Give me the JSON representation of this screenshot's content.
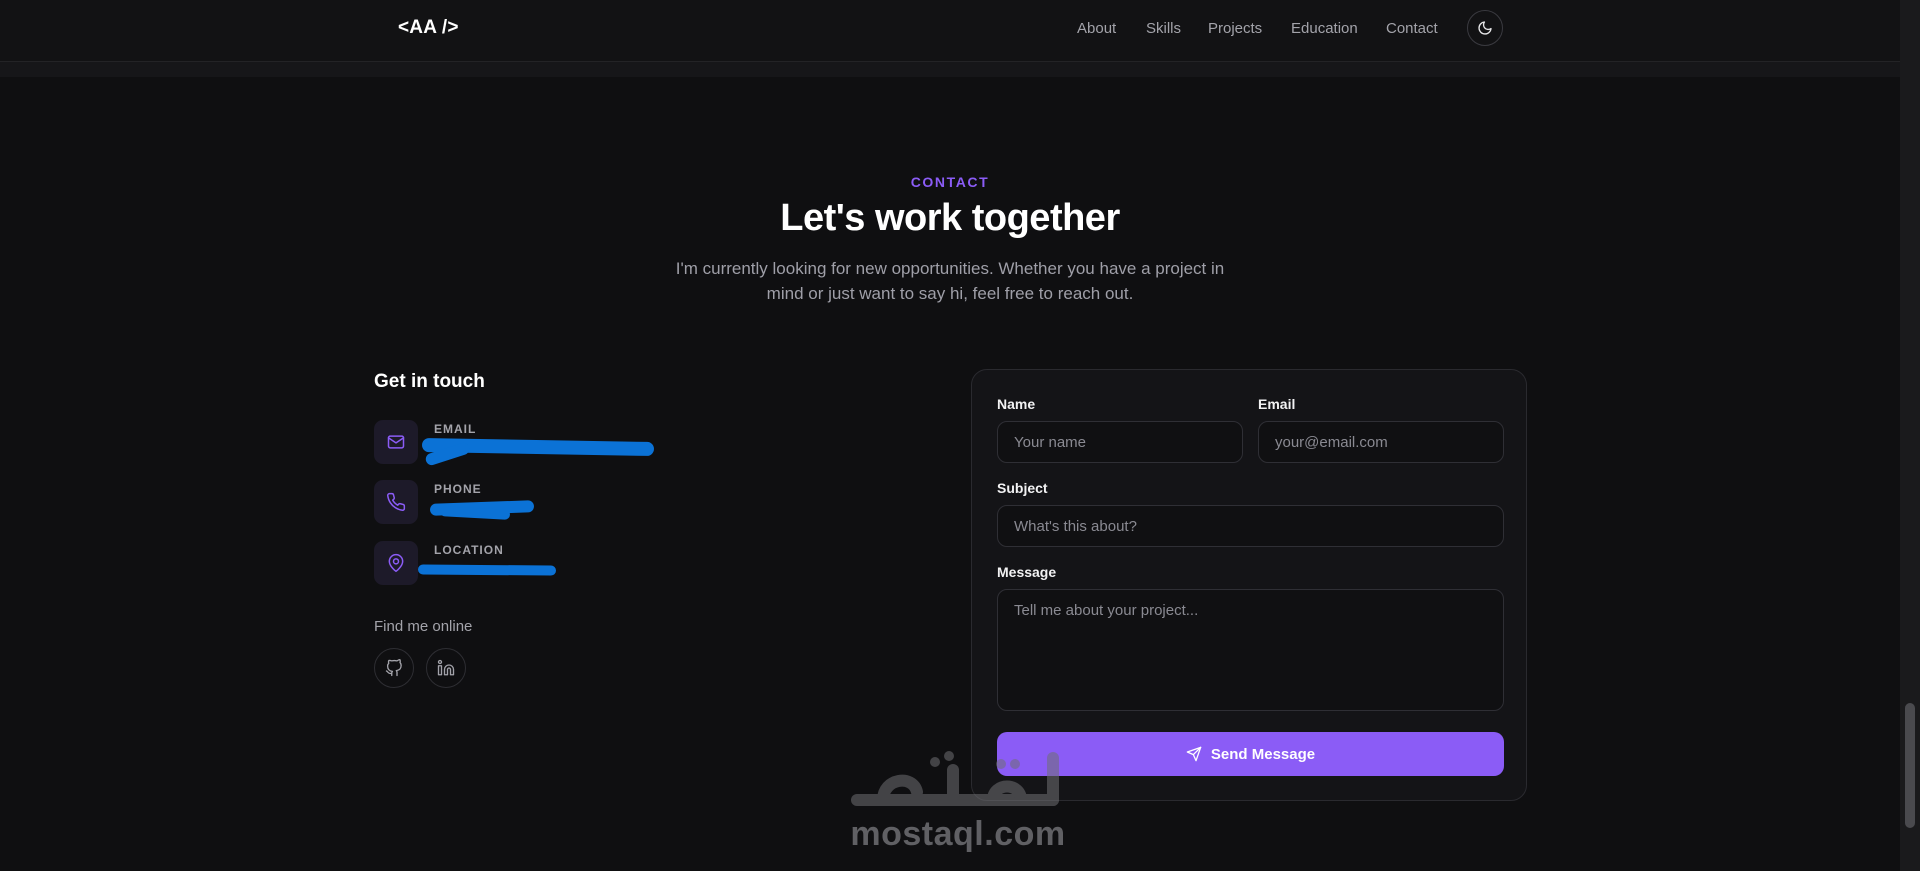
{
  "header": {
    "logo": "<AA />",
    "nav": [
      "About",
      "Skills",
      "Projects",
      "Education",
      "Contact"
    ],
    "theme_icon": "moon-icon"
  },
  "section": {
    "eyebrow": "CONTACT",
    "title": "Let's work together",
    "subtitle": "I'm currently looking for new opportunities. Whether you have a project in mind or just want to say hi, feel free to reach out."
  },
  "get_in_touch": {
    "title": "Get in touch",
    "items": [
      {
        "label": "EMAIL",
        "icon": "mail-icon",
        "value": ""
      },
      {
        "label": "PHONE",
        "icon": "phone-icon",
        "value": ""
      },
      {
        "label": "LOCATION",
        "icon": "map-pin-icon",
        "value": ""
      }
    ],
    "find_online": "Find me online",
    "socials": [
      {
        "icon": "github-icon"
      },
      {
        "icon": "linkedin-icon"
      }
    ]
  },
  "form": {
    "name_label": "Name",
    "name_placeholder": "Your name",
    "email_label": "Email",
    "email_placeholder": "your@email.com",
    "subject_label": "Subject",
    "subject_placeholder": "What's this about?",
    "message_label": "Message",
    "message_placeholder": "Tell me about your project...",
    "submit_label": "Send Message",
    "submit_icon": "send-icon"
  },
  "watermark": {
    "text": "mostaql.com"
  },
  "colors": {
    "accent": "#8b5cf6",
    "background": "#0f0f11",
    "redaction": "#0b72d6"
  }
}
